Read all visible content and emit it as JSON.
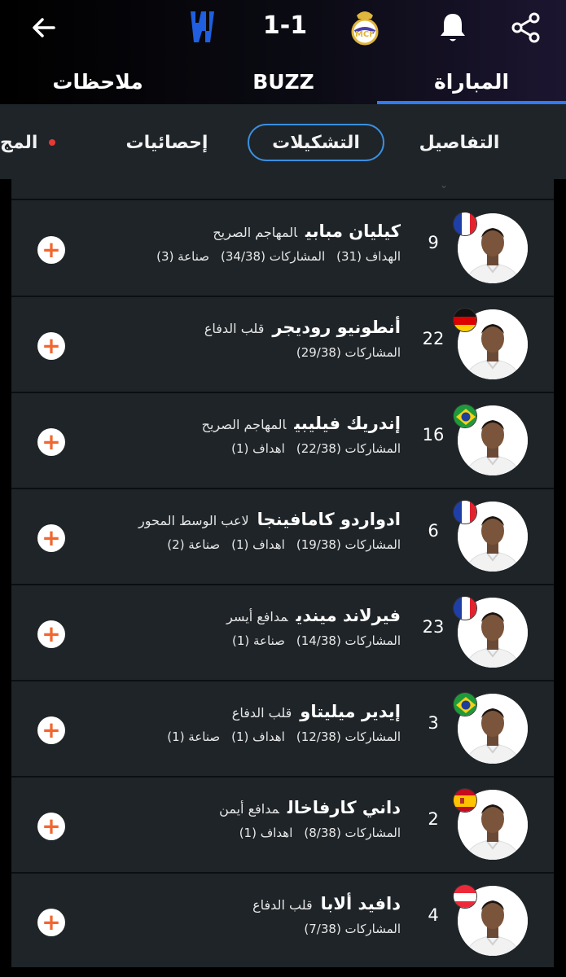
{
  "header": {
    "score": "1-1",
    "back_icon": "arrow-left-icon",
    "bell_icon": "bell-icon",
    "share_icon": "share-icon",
    "home_club_icon": "al-hilal-crest-icon",
    "away_club_icon": "real-madrid-crest-icon",
    "colors": {
      "accent": "#2f7bf6",
      "plus": "#f0672f"
    }
  },
  "top_tabs": [
    {
      "label": "ملاحظات"
    },
    {
      "label": "BUZZ"
    },
    {
      "label": "المباراة"
    }
  ],
  "sub_tabs": [
    {
      "label": "المج"
    },
    {
      "label": "إحصائيات"
    },
    {
      "label": "التشكيلات"
    },
    {
      "label": "التفاصيل"
    }
  ],
  "players": [
    {
      "name": "كيليان مبابي",
      "position": "المهاجم الصريح",
      "number": "9",
      "flag": "france",
      "stats": [
        "الهداف (31)",
        "المشاركات (34/38)",
        "صناعة (3)"
      ]
    },
    {
      "name": "أنطونيو روديجر",
      "position": "قلب الدفاع",
      "number": "22",
      "flag": "germany",
      "stats": [
        "المشاركات (29/38)"
      ]
    },
    {
      "name": "إندريك فيليبي",
      "position": "المهاجم الصريح",
      "number": "16",
      "flag": "brazil",
      "stats": [
        "المشاركات (22/38)",
        "اهداف (1)"
      ]
    },
    {
      "name": "ادواردو كامافينجا",
      "position": "لاعب الوسط المحور",
      "number": "6",
      "flag": "france",
      "stats": [
        "المشاركات (19/38)",
        "اهداف (1)",
        "صناعة (2)"
      ]
    },
    {
      "name": "فيرلاند ميندي",
      "position": "مدافع أيسر",
      "number": "23",
      "flag": "france",
      "stats": [
        "المشاركات (14/38)",
        "صناعة (1)"
      ]
    },
    {
      "name": "إيدير ميليتاو",
      "position": "قلب الدفاع",
      "number": "3",
      "flag": "brazil",
      "stats": [
        "المشاركات (12/38)",
        "اهداف (1)",
        "صناعة (1)"
      ]
    },
    {
      "name": "داني كارفاخال",
      "position": "مدافع أيمن",
      "number": "2",
      "flag": "spain",
      "stats": [
        "المشاركات (8/38)",
        "اهداف (1)"
      ]
    },
    {
      "name": "دافيد ألابا",
      "position": "قلب الدفاع",
      "number": "4",
      "flag": "austria",
      "stats": [
        "المشاركات (7/38)"
      ]
    }
  ]
}
